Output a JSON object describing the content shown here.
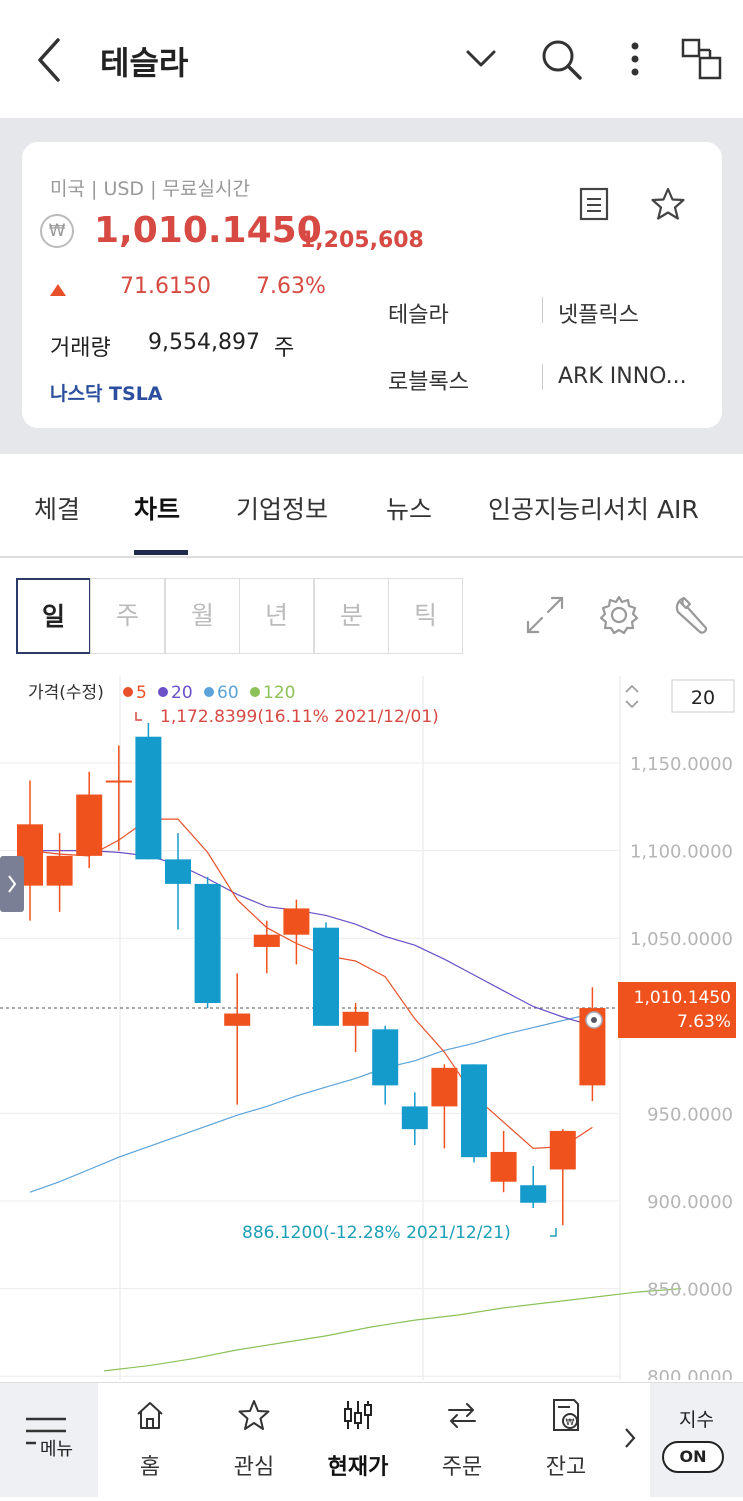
{
  "header": {
    "title": "테슬라"
  },
  "quote": {
    "meta": "미국 | USD | 무료실시간",
    "currency_symbol": "₩",
    "price": "1,010.1450",
    "price_krw": "1,205,608",
    "change": "71.6150",
    "change_pct": "7.63%",
    "volume_label": "거래량",
    "volume": "9,554,897",
    "volume_unit": "주",
    "exchange": "나스닥 TSLA",
    "related": [
      "테슬라",
      "넷플릭스",
      "로블록스",
      "ARK INNO..."
    ],
    "colors": {
      "up": "#d64a43",
      "exchange": "#2b4f9e"
    }
  },
  "tabs": [
    "체결",
    "차트",
    "기업정보",
    "뉴스",
    "인공지능리서치 AIR"
  ],
  "periods": [
    "일",
    "주",
    "월",
    "년",
    "분",
    "틱"
  ],
  "chart_data": {
    "type": "candlestick",
    "legend": {
      "label": "가격(수정)",
      "ma": [
        {
          "name": "5",
          "color": "#e8502a"
        },
        {
          "name": "20",
          "color": "#6a4fc7"
        },
        {
          "name": "60",
          "color": "#5ba3d9"
        },
        {
          "name": "120",
          "color": "#8cc25a"
        }
      ]
    },
    "period_count": "20",
    "y_ticks": [
      "1,150.0000",
      "1,100.0000",
      "1,050.0000",
      "950.0000",
      "900.0000",
      "850.0000",
      "800.0000"
    ],
    "high_annotation": "1,172.8399(16.11% 2021/12/01)",
    "low_annotation": "886.1200(-12.28% 2021/12/21)",
    "last_price": "1,010.1450",
    "last_pct": "7.63%",
    "candles": [
      {
        "o": 1080,
        "h": 1140,
        "l": 1060,
        "c": 1115
      },
      {
        "o": 1080,
        "h": 1110,
        "l": 1065,
        "c": 1097
      },
      {
        "o": 1097,
        "h": 1145,
        "l": 1090,
        "c": 1132
      },
      {
        "o": 1140,
        "h": 1160,
        "l": 1100,
        "c": 1140
      },
      {
        "o": 1165,
        "h": 1172.84,
        "l": 1095,
        "c": 1095
      },
      {
        "o": 1095,
        "h": 1110,
        "l": 1055,
        "c": 1081
      },
      {
        "o": 1081,
        "h": 1085,
        "l": 1010,
        "c": 1013
      },
      {
        "o": 1000,
        "h": 1030,
        "l": 955,
        "c": 1007
      },
      {
        "o": 1045,
        "h": 1060,
        "l": 1030,
        "c": 1052
      },
      {
        "o": 1052,
        "h": 1072,
        "l": 1035,
        "c": 1067
      },
      {
        "o": 1056,
        "h": 1059,
        "l": 1000,
        "c": 1000
      },
      {
        "o": 1000,
        "h": 1013,
        "l": 985,
        "c": 1008
      },
      {
        "o": 998,
        "h": 1000,
        "l": 955,
        "c": 966
      },
      {
        "o": 954,
        "h": 962,
        "l": 932,
        "c": 941
      },
      {
        "o": 954,
        "h": 978,
        "l": 930,
        "c": 976
      },
      {
        "o": 978,
        "h": 978,
        "l": 922,
        "c": 925
      },
      {
        "o": 911,
        "h": 940,
        "l": 905,
        "c": 928
      },
      {
        "o": 909,
        "h": 920,
        "l": 896,
        "c": 899
      },
      {
        "o": 918,
        "h": 941,
        "l": 886.12,
        "c": 940
      },
      {
        "o": 966,
        "h": 1022,
        "l": 957,
        "c": 1010.145
      }
    ],
    "ma5": [
      1100,
      1098,
      1097,
      1106,
      1118,
      1118,
      1099,
      1072,
      1056,
      1047,
      1040,
      1037,
      1028,
      1004,
      985,
      960,
      945,
      930,
      931,
      942
    ],
    "ma20": [
      1100,
      1100,
      1100,
      1099,
      1097,
      1092,
      1084,
      1075,
      1068,
      1066,
      1063,
      1058,
      1051,
      1046,
      1038,
      1029,
      1020,
      1011,
      1005,
      1000
    ],
    "ma60": [
      905,
      911,
      918,
      925,
      931,
      937,
      943,
      949,
      954,
      960,
      965,
      970,
      976,
      980,
      986,
      990,
      995,
      999,
      1003,
      1007
    ],
    "ma120": [
      803,
      806,
      810,
      815,
      819,
      823,
      828,
      832,
      835,
      839,
      842,
      845,
      848,
      850
    ],
    "ylim": [
      790,
      1180
    ],
    "colors": {
      "up": "#f0521e",
      "down": "#159bcb"
    }
  },
  "bottom_nav": {
    "menu_label": "메뉴",
    "items": [
      "홈",
      "관심",
      "현재가",
      "주문",
      "잔고"
    ],
    "index_label": "지수",
    "index_toggle": "ON"
  }
}
